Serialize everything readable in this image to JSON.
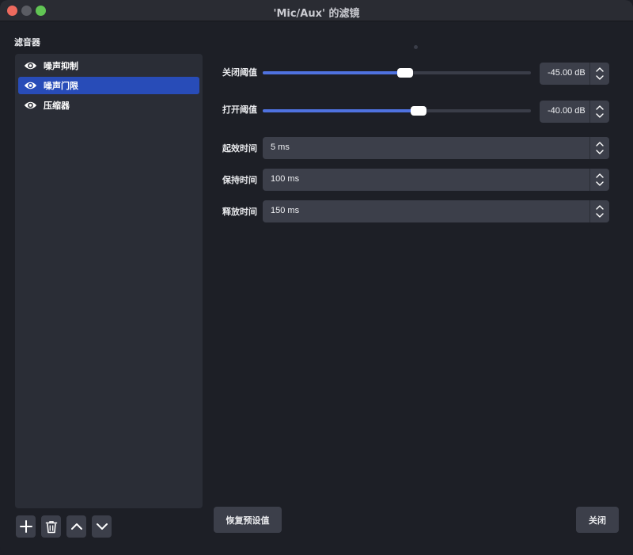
{
  "window": {
    "title": "'Mic/Aux' 的滤镜"
  },
  "filters_panel": {
    "label": "滤音器",
    "items": [
      {
        "label": "噪声抑制",
        "icon": "eye-icon",
        "selected": false
      },
      {
        "label": "噪声门限",
        "icon": "eye-icon",
        "selected": true
      },
      {
        "label": "压缩器",
        "icon": "eye-icon",
        "selected": false
      }
    ],
    "toolbar": {
      "add_icon": "plus-icon",
      "remove_icon": "trash-icon",
      "move_up_icon": "chevron-up-icon",
      "move_down_icon": "chevron-down-icon"
    }
  },
  "properties": {
    "close_threshold": {
      "label": "关闭阈值",
      "value": "-45.00 dB",
      "slider_fraction": 0.53
    },
    "open_threshold": {
      "label": "打开阈值",
      "value": "-40.00 dB",
      "slider_fraction": 0.58
    },
    "attack_time": {
      "label": "起效时间",
      "value": "5 ms"
    },
    "hold_time": {
      "label": "保持时间",
      "value": "100 ms"
    },
    "release_time": {
      "label": "释放时间",
      "value": "150 ms"
    }
  },
  "buttons": {
    "restore_defaults": "恢复预设值",
    "close": "关闭"
  },
  "colors": {
    "accent": "#284cb8",
    "slider_fill": "#4f72e0",
    "background": "#1d1f26",
    "panel": "#2a2d36",
    "control": "#3c3f4a"
  }
}
